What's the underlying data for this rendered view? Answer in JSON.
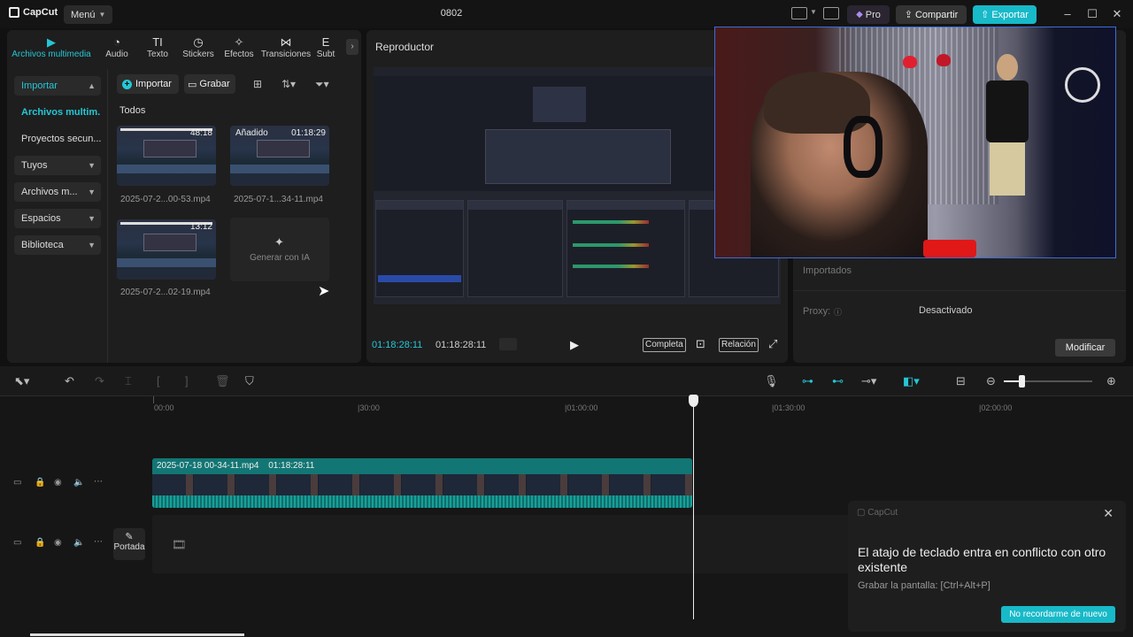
{
  "topbar": {
    "logo": "CapCut",
    "menu": "Menú",
    "project_title": "0802",
    "pro": "Pro",
    "share": "Compartir",
    "export": "Exportar"
  },
  "media": {
    "tabs": [
      {
        "label": "Archivos multimedia",
        "icon": "media-icon"
      },
      {
        "label": "Audio",
        "icon": "audio-icon"
      },
      {
        "label": "Texto",
        "icon": "text-icon"
      },
      {
        "label": "Stickers",
        "icon": "sticker-icon"
      },
      {
        "label": "Efectos",
        "icon": "effects-icon"
      },
      {
        "label": "Transiciones",
        "icon": "transitions-icon"
      },
      {
        "label": "Subt",
        "icon": "subtitles-icon"
      }
    ],
    "sidebar": [
      {
        "label": "Importar"
      },
      {
        "label": "Archivos multim..."
      },
      {
        "label": "Proyectos secun..."
      },
      {
        "label": "Tuyos"
      },
      {
        "label": "Archivos m..."
      },
      {
        "label": "Espacios"
      },
      {
        "label": "Biblioteca"
      }
    ],
    "import_btn": "Importar",
    "record_btn": "Grabar",
    "section_title": "Todos",
    "items": [
      {
        "name": "2025-07-2...00-53.mp4",
        "duration": "48:18",
        "badge": ""
      },
      {
        "name": "2025-07-1...34-11.mp4",
        "duration": "01:18:29",
        "badge": "Añadido"
      },
      {
        "name": "2025-07-2...02-19.mp4",
        "duration": "13:12",
        "badge": ""
      }
    ],
    "generate_ai": "Generar con IA"
  },
  "player": {
    "title": "Reproductor",
    "current_time": "01:18:28:11",
    "total_time": "01:18:28:11",
    "full_label": "Completa",
    "ratio_label": "Relación"
  },
  "details": {
    "imported_label": "Importados",
    "proxy_label": "Proxy:",
    "proxy_value": "Desactivado",
    "modify": "Modificar"
  },
  "timeline": {
    "ruler": [
      "00:00",
      "|30:00",
      "|01:00:00",
      "|01:30:00",
      "|02:00:00"
    ],
    "clip_name": "2025-07-18 00-34-11.mp4",
    "clip_duration": "01:18:28:11",
    "cover": "Portada"
  },
  "toast": {
    "app": "CapCut",
    "message": "El atajo de teclado entra en conflicto con otro existente",
    "sub": "Grabar la pantalla: [Ctrl+Alt+P]",
    "button": "No recordarme de nuevo"
  },
  "colors": {
    "accent": "#18b9c8",
    "clip": "#0f6e6c"
  }
}
